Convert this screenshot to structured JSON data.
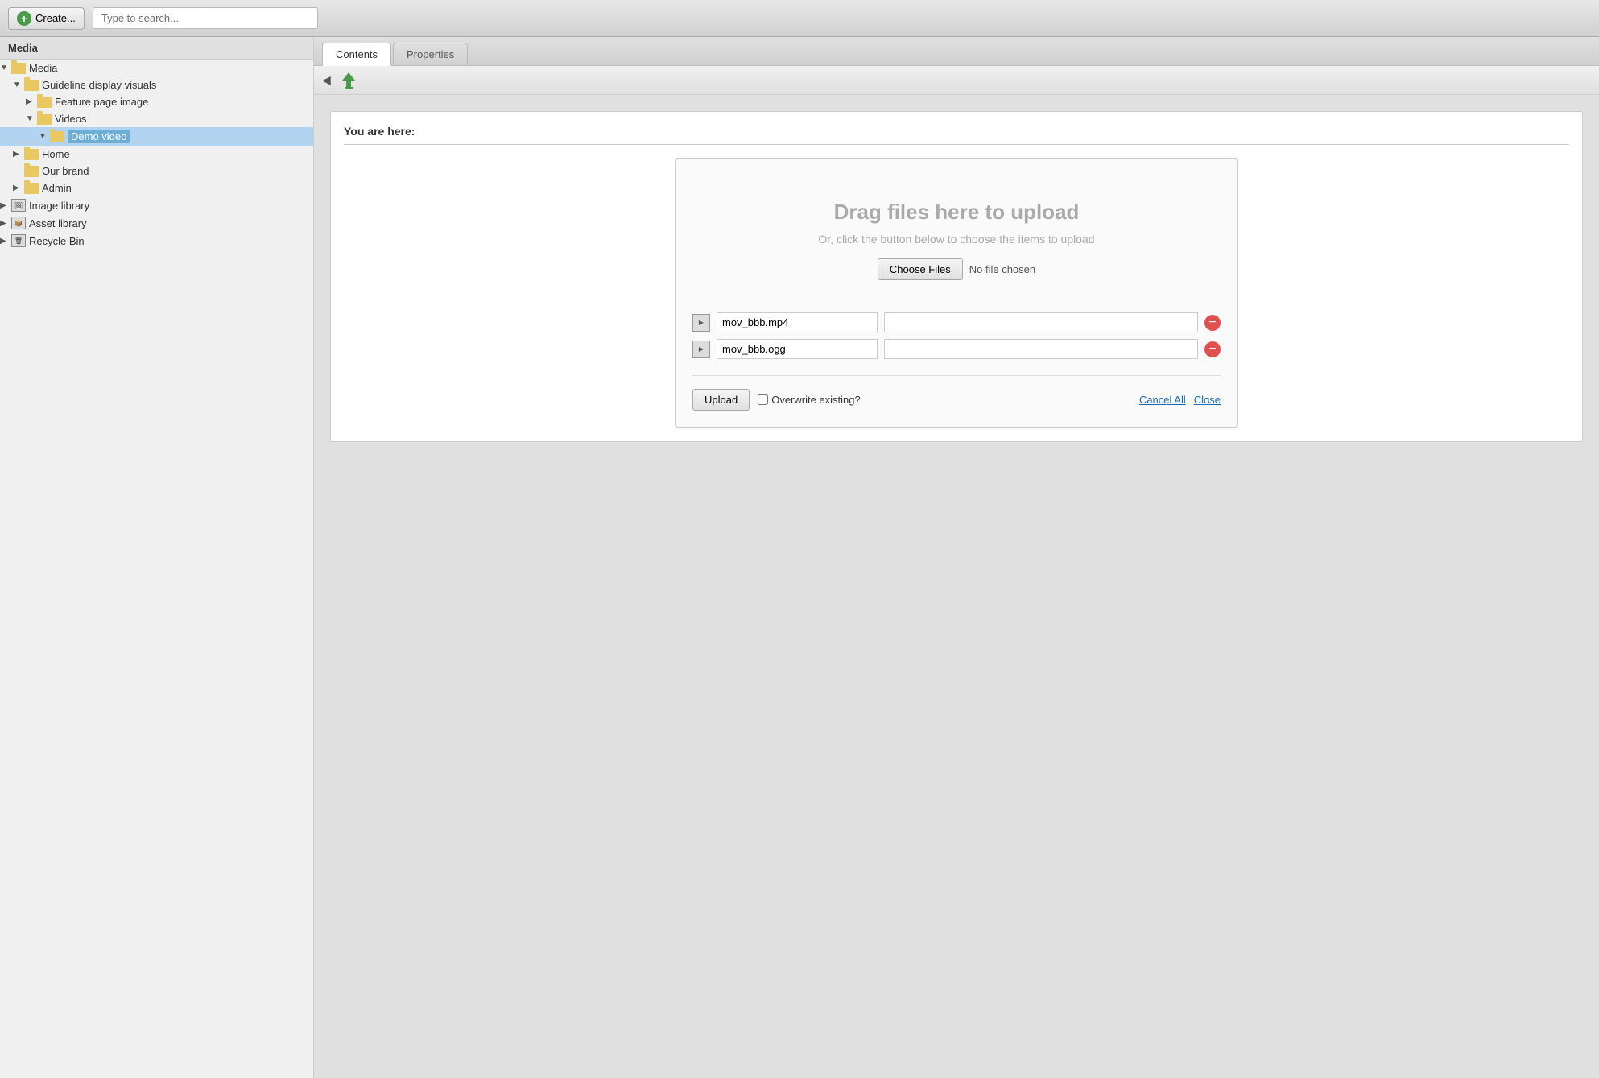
{
  "topbar": {
    "create_label": "Create...",
    "search_placeholder": "Type to search..."
  },
  "sidebar": {
    "header": "Media",
    "tree": [
      {
        "id": "media-root",
        "label": "Media",
        "depth": 0,
        "type": "folder-open",
        "expanded": true,
        "arrow": "▼"
      },
      {
        "id": "guideline",
        "label": "Guideline display visuals",
        "depth": 1,
        "type": "folder-open",
        "expanded": true,
        "arrow": "▼"
      },
      {
        "id": "feature-page",
        "label": "Feature page image",
        "depth": 2,
        "type": "folder",
        "expanded": false,
        "arrow": "▶"
      },
      {
        "id": "videos",
        "label": "Videos",
        "depth": 2,
        "type": "folder-open",
        "expanded": true,
        "arrow": "▼"
      },
      {
        "id": "demo-video",
        "label": "Demo video",
        "depth": 3,
        "type": "folder-open",
        "expanded": true,
        "arrow": "▼",
        "selected": true
      },
      {
        "id": "home",
        "label": "Home",
        "depth": 1,
        "type": "folder",
        "expanded": false,
        "arrow": "▶"
      },
      {
        "id": "our-brand",
        "label": "Our brand",
        "depth": 1,
        "type": "folder",
        "expanded": false,
        "arrow": ""
      },
      {
        "id": "admin",
        "label": "Admin",
        "depth": 1,
        "type": "folder",
        "expanded": false,
        "arrow": "▶"
      },
      {
        "id": "image-library",
        "label": "Image library",
        "depth": 0,
        "type": "special",
        "expanded": false,
        "arrow": "▶"
      },
      {
        "id": "asset-library",
        "label": "Asset library",
        "depth": 0,
        "type": "special2",
        "expanded": false,
        "arrow": "▶"
      },
      {
        "id": "recycle-bin",
        "label": "Recycle Bin",
        "depth": 0,
        "type": "special3",
        "expanded": false,
        "arrow": "▶"
      }
    ]
  },
  "tabs": [
    {
      "id": "contents",
      "label": "Contents",
      "active": true
    },
    {
      "id": "properties",
      "label": "Properties",
      "active": false
    }
  ],
  "content": {
    "you_are_here_label": "You are here:",
    "drag_title": "Drag files here to upload",
    "drag_subtitle": "Or, click the button below to choose the items to upload",
    "choose_files_label": "Choose Files",
    "no_file_text": "No file chosen",
    "files": [
      {
        "id": "file1",
        "name": "mov_bbb.mp4",
        "title": ""
      },
      {
        "id": "file2",
        "name": "mov_bbb.ogg",
        "title": ""
      }
    ],
    "upload_label": "Upload",
    "overwrite_label": "Overwrite existing?",
    "cancel_all_label": "Cancel All",
    "close_label": "Close"
  }
}
